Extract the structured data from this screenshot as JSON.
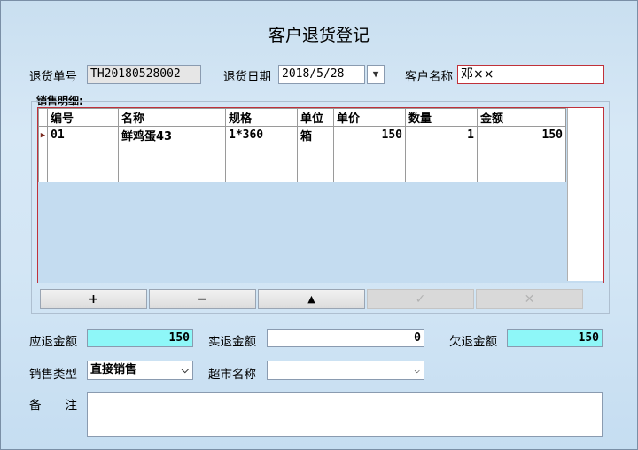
{
  "title": "客户退货登记",
  "return_no": {
    "label": "退货单号",
    "value": "TH20180528002"
  },
  "return_date": {
    "label": "退货日期",
    "value": "2018/5/28"
  },
  "customer": {
    "label": "客户名称",
    "value": "邓××"
  },
  "detail": {
    "label": "销售明细:",
    "columns": [
      "编号",
      "名称",
      "规格",
      "单位",
      "单价",
      "数量",
      "金额"
    ],
    "rows": [
      {
        "no": "01",
        "name": "鲜鸡蛋43",
        "spec": "1*360",
        "unit": "箱",
        "price": "150",
        "qty": "1",
        "amount": "150"
      }
    ]
  },
  "toolbar": {
    "add": "+",
    "remove": "−",
    "up": "▲",
    "confirm": "✓",
    "cancel": "✕"
  },
  "due_refund": {
    "label": "应退金额",
    "value": "150"
  },
  "actual_refund": {
    "label": "实退金额",
    "value": "0"
  },
  "owed_refund": {
    "label": "欠退金额",
    "value": "150"
  },
  "sale_type": {
    "label": "销售类型",
    "value": "直接销售"
  },
  "market": {
    "label": "超市名称",
    "value": ""
  },
  "remark": {
    "label": "备　　注",
    "value": ""
  },
  "icons": {
    "dropdown": "chevron-down-icon",
    "row_indicator": "triangle-right-icon"
  },
  "colors": {
    "highlight": "#8ef7f8",
    "focus_border": "#c0313a"
  }
}
